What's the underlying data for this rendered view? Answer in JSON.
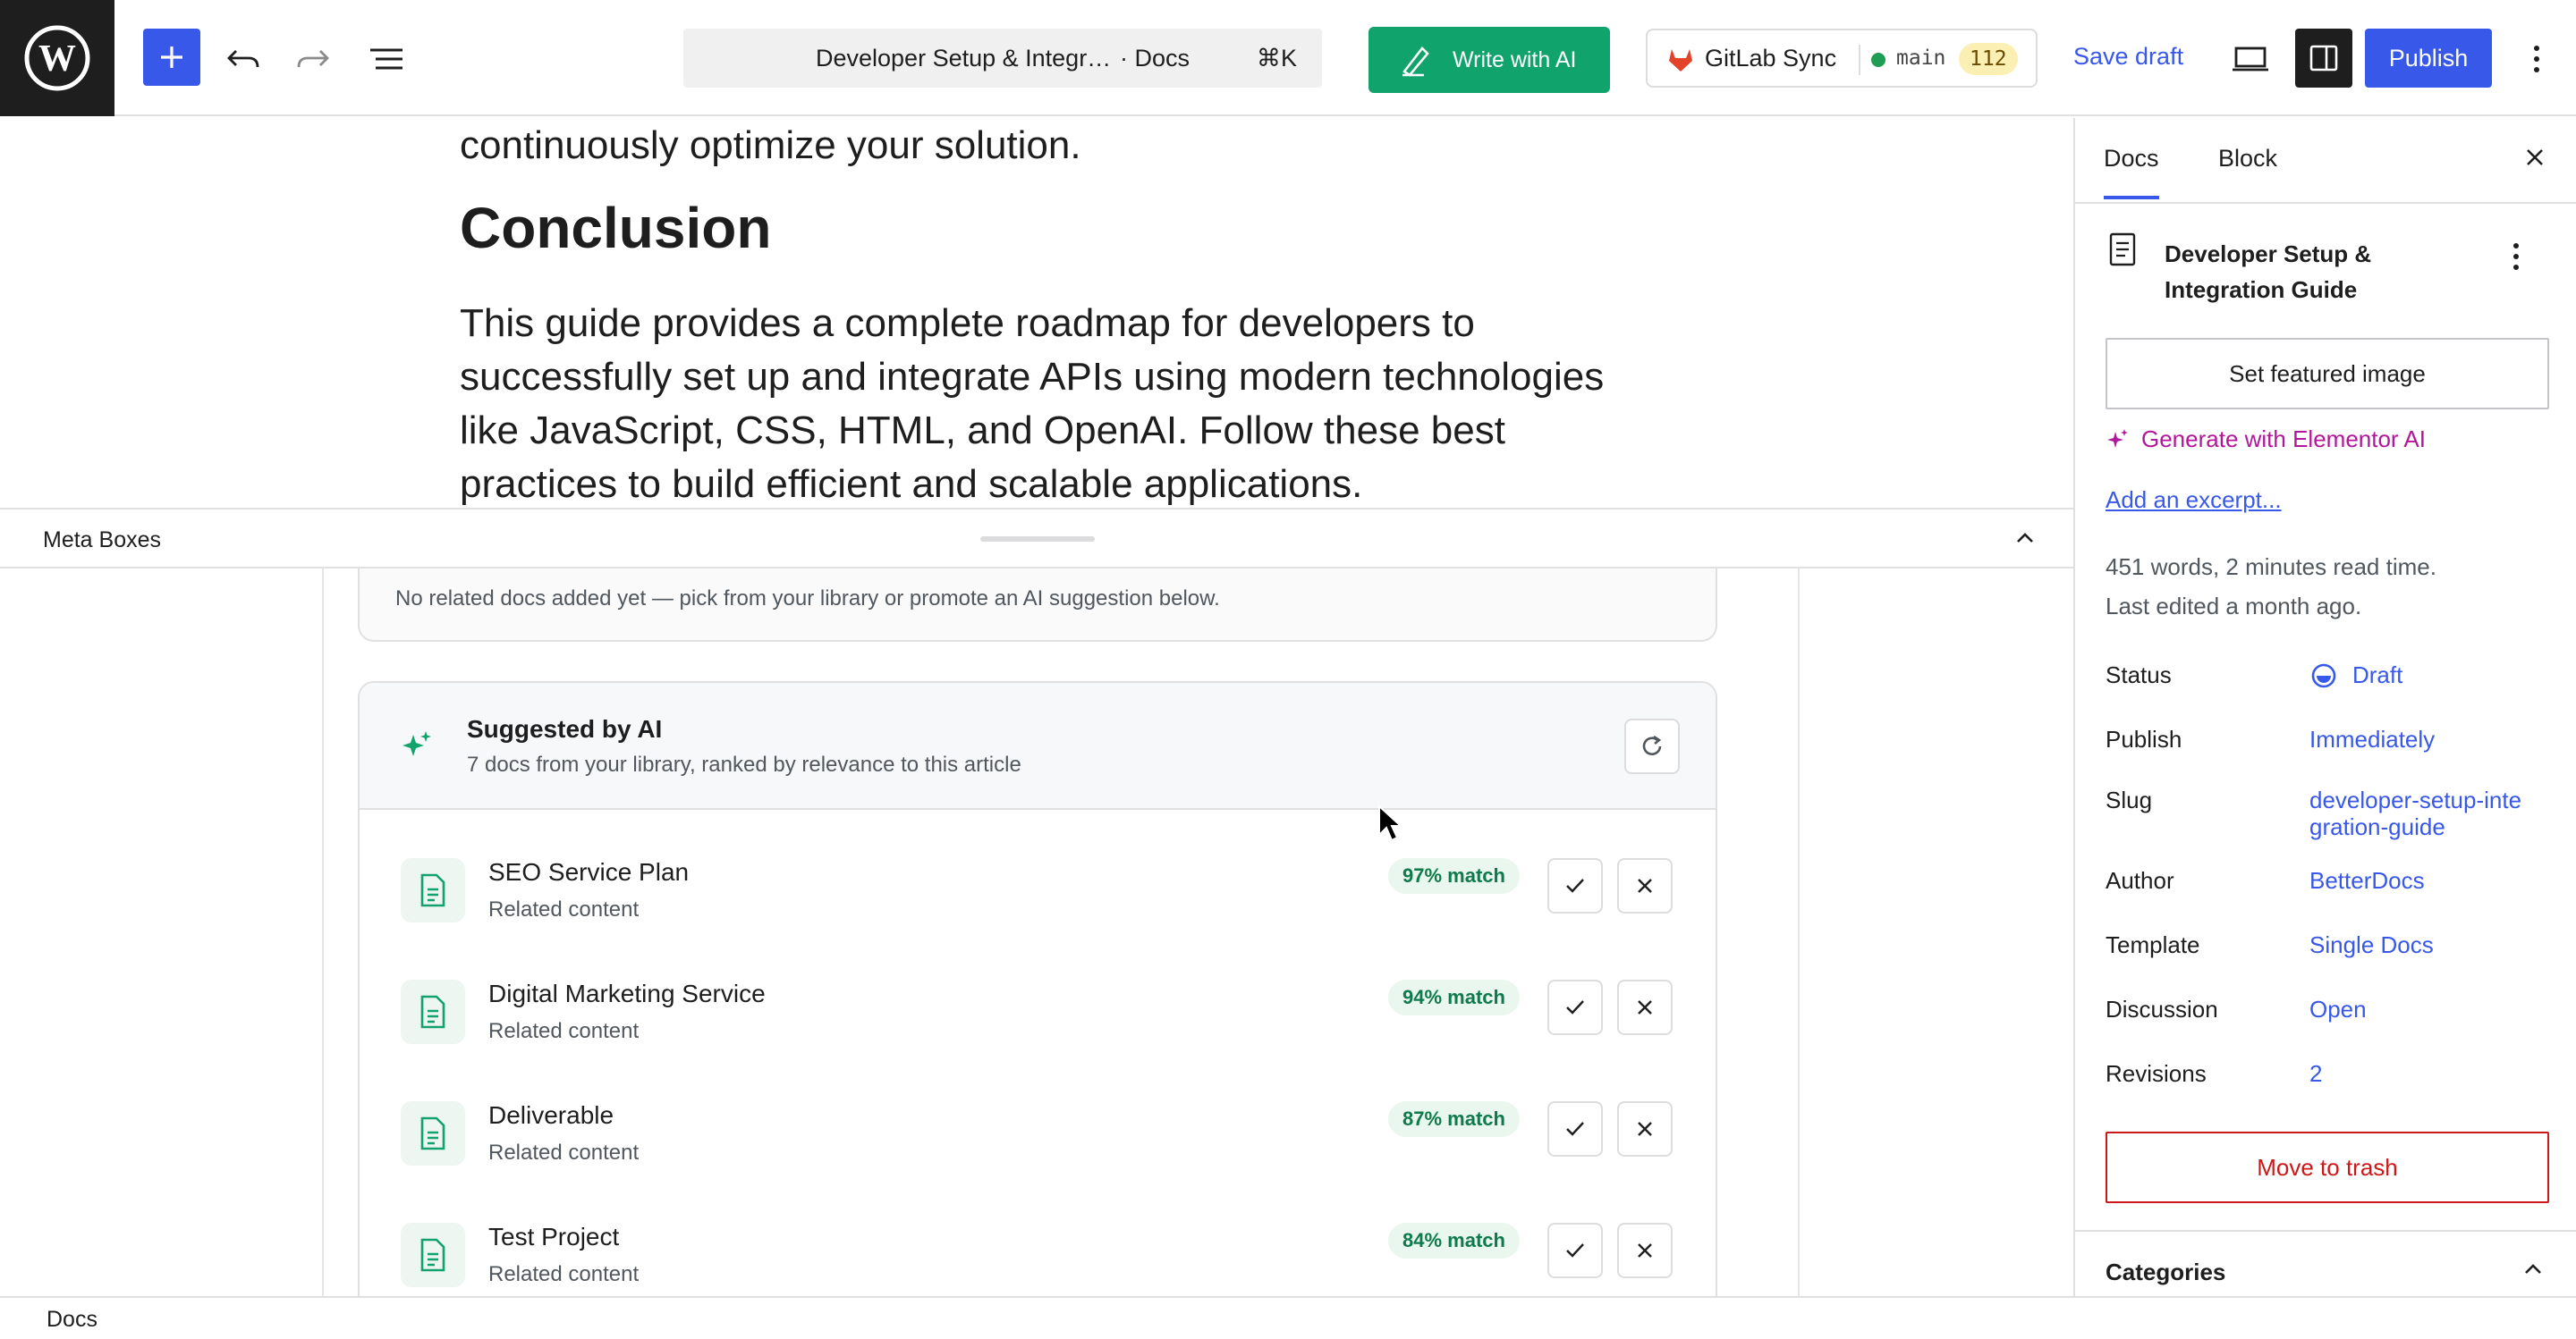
{
  "toolbar": {
    "command": {
      "title": "Developer Setup & Integr…",
      "type": "· Docs",
      "shortcut": "⌘K"
    },
    "write_ai_label": "Write with AI",
    "gitlab": {
      "label": "GitLab Sync",
      "branch": "main",
      "count": "112"
    },
    "save_draft_label": "Save draft",
    "publish_label": "Publish"
  },
  "editor": {
    "para_top": "continuously optimize your solution.",
    "heading": "Conclusion",
    "paragraph": "This guide provides a complete roadmap for developers to successfully set up and integrate APIs using modern technologies like JavaScript, CSS, HTML, and OpenAI. Follow these best practices to build efficient and scalable applications."
  },
  "meta": {
    "bar_label": "Meta Boxes",
    "empty_text": "No related docs added yet — pick from your library or promote an AI suggestion below.",
    "suggest": {
      "title": "Suggested by AI",
      "subtitle": "7 docs from your library, ranked by relevance to this article",
      "items": [
        {
          "name": "SEO Service Plan",
          "desc": "Related content",
          "match": "97% match"
        },
        {
          "name": "Digital Marketing Service",
          "desc": "Related content",
          "match": "94% match"
        },
        {
          "name": "Deliverable",
          "desc": "Related content",
          "match": "87% match"
        },
        {
          "name": "Test Project",
          "desc": "Related content",
          "match": "84% match"
        }
      ]
    }
  },
  "sidebar": {
    "tabs": [
      "Docs",
      "Block"
    ],
    "doc_title": "Developer Setup & Integration Guide",
    "featured_label": "Set featured image",
    "gen_ai_label": "Generate with Elementor AI",
    "excerpt_label": "Add an excerpt...",
    "words": "451 words, 2 minutes read time.",
    "edited": "Last edited a month ago.",
    "rows": [
      {
        "k": "Status",
        "v": "Draft"
      },
      {
        "k": "Publish",
        "v": "Immediately"
      },
      {
        "k": "Slug",
        "v": "developer-setup-integration-guide"
      },
      {
        "k": "Author",
        "v": "BetterDocs"
      },
      {
        "k": "Template",
        "v": "Single Docs"
      },
      {
        "k": "Discussion",
        "v": "Open"
      },
      {
        "k": "Revisions",
        "v": "2"
      }
    ],
    "trash_label": "Move to trash",
    "categories_label": "Categories"
  },
  "footer": {
    "breadcrumb": "Docs"
  },
  "colors": {
    "accent": "#3858e9",
    "ai_green": "#10a36b",
    "danger": "#cc1818",
    "elementor": "#b2169a"
  }
}
